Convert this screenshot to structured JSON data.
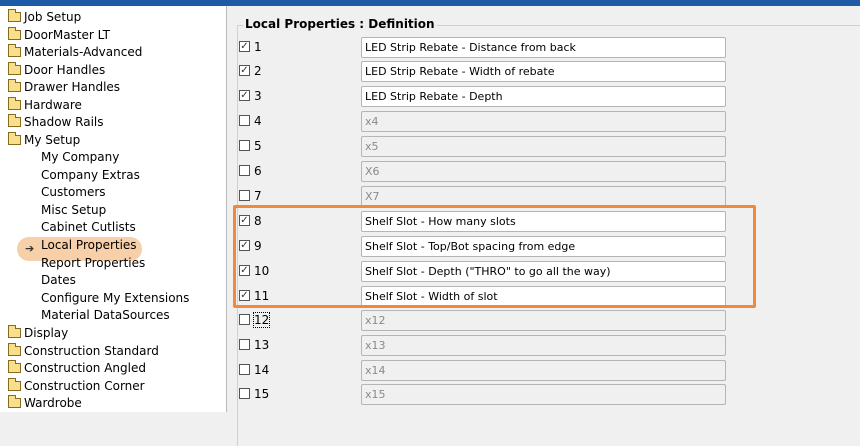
{
  "sidebar": {
    "top_items": [
      "Job Setup",
      "DoorMaster LT",
      "Materials-Advanced",
      "Door Handles",
      "Drawer Handles",
      "Hardware",
      "Shadow Rails",
      "My Setup"
    ],
    "my_setup_children": [
      "My Company",
      "Company Extras",
      "Customers",
      "Misc Setup",
      "Cabinet Cutlists",
      "Local Properties",
      "Report Properties",
      "Dates",
      "Configure My Extensions",
      "Material DataSources"
    ],
    "selected": "Local Properties",
    "bottom_items": [
      "Display",
      "Construction Standard",
      "Construction Angled",
      "Construction Corner",
      "Wardrobe"
    ]
  },
  "panel": {
    "title": "Local Properties : Definition",
    "rows": [
      {
        "num": "1",
        "checked": true,
        "value": "LED Strip Rebate - Distance from back"
      },
      {
        "num": "2",
        "checked": true,
        "value": "LED Strip Rebate - Width of rebate"
      },
      {
        "num": "3",
        "checked": true,
        "value": "LED Strip Rebate - Depth"
      },
      {
        "num": "4",
        "checked": false,
        "value": "x4"
      },
      {
        "num": "5",
        "checked": false,
        "value": "x5"
      },
      {
        "num": "6",
        "checked": false,
        "value": "X6"
      },
      {
        "num": "7",
        "checked": false,
        "value": "X7"
      },
      {
        "num": "8",
        "checked": true,
        "value": "Shelf Slot - How many slots"
      },
      {
        "num": "9",
        "checked": true,
        "value": "Shelf Slot - Top/Bot spacing from edge"
      },
      {
        "num": "10",
        "checked": true,
        "value": "Shelf Slot - Depth (\"THRO\" to go all the way)"
      },
      {
        "num": "11",
        "checked": true,
        "value": "Shelf Slot - Width of slot"
      },
      {
        "num": "12",
        "checked": false,
        "value": "x12"
      },
      {
        "num": "13",
        "checked": false,
        "value": "x13"
      },
      {
        "num": "14",
        "checked": false,
        "value": "x14"
      },
      {
        "num": "15",
        "checked": false,
        "value": "x15"
      }
    ]
  },
  "colors": {
    "highlight": "#f08a3a",
    "selection": "#f7cfa9",
    "titlebar": "#1f5aa6"
  }
}
